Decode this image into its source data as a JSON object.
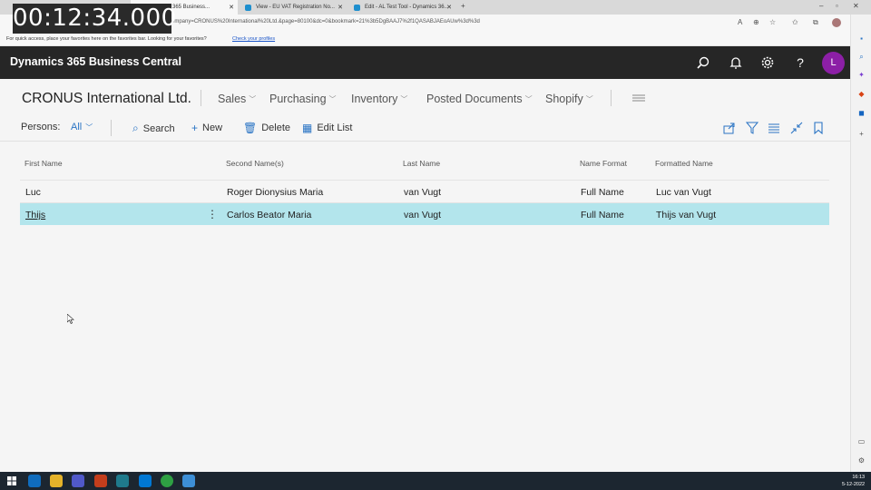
{
  "timer": "00:12:34.000",
  "browser": {
    "tabs": [
      {
        "label": "Dynamics 365 Business..."
      },
      {
        "label": "View - EU VAT Registration No..."
      },
      {
        "label": "Edit - AL Test Tool - Dynamics 36..."
      }
    ],
    "url": "company=CRONUS%20International%20Ltd.&page=80100&dc=0&bookmark=21%3b5DgBAAJ7%2f1QASABJAEoAUw%3d%3d",
    "favorites_text": "For quick access, place your favorites here on the favorites bar. Looking for your favorites?",
    "favorites_link": "Check your profiles"
  },
  "app": {
    "title": "Dynamics 365 Business Central",
    "avatar_initial": "L",
    "avatar_color": "#8c1fa6"
  },
  "company_nav": {
    "company": "CRONUS International Ltd.",
    "menus": [
      "Sales",
      "Purchasing",
      "Inventory",
      "Posted Documents",
      "Shopify"
    ]
  },
  "actions": {
    "filter_label": "Persons:",
    "filter_value": "All",
    "search": "Search",
    "new": "New",
    "delete": "Delete",
    "edit_list": "Edit List"
  },
  "table": {
    "columns": [
      "First Name",
      "Second Name(s)",
      "Last Name",
      "Name Format",
      "Formatted Name"
    ],
    "rows": [
      {
        "first": "Luc",
        "second": "Roger Dionysius Maria",
        "last": "van Vugt",
        "format": "Full Name",
        "formatted": "Luc van Vugt"
      },
      {
        "first": "Thijs",
        "second": "Carlos Beator Maria",
        "last": "van Vugt",
        "format": "Full Name",
        "formatted": "Thijs van Vugt"
      }
    ],
    "selected_color": "#b3e5ec"
  },
  "taskbar": {
    "time": "16:13",
    "date": "5-12-2022"
  }
}
